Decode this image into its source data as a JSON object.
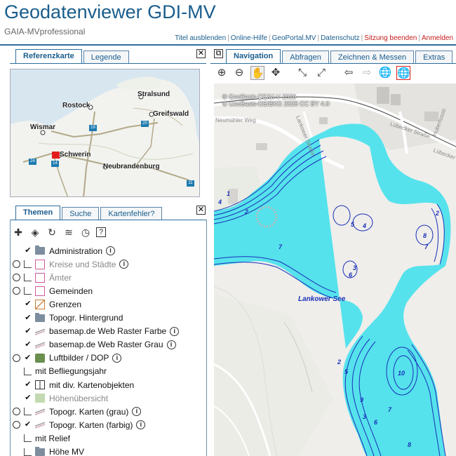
{
  "header": {
    "title": "Geodatenviewer GDI-MV",
    "subtitle": "GAIA-MVprofessional",
    "links": [
      {
        "label": "Titel ausblenden",
        "color": "#1a5d8c"
      },
      {
        "label": "Online-Hilfe",
        "color": "#1a5d8c"
      },
      {
        "label": "GeoPortal.MV",
        "color": "#1a5d8c"
      },
      {
        "label": "Datenschutz",
        "color": "#1a5d8c"
      },
      {
        "label": "Sitzung beenden",
        "color": "#c41b1b"
      },
      {
        "label": "Anmelden",
        "color": "#c41b1b"
      }
    ]
  },
  "left_top_tabs": [
    "Referenzkarte",
    "Legende"
  ],
  "refmap": {
    "cities": [
      "Stralsund",
      "Rostock",
      "Greifswald",
      "Wismar",
      "Schwerin",
      "Neubrandenburg"
    ],
    "road_badges": [
      "19",
      "20",
      "24",
      "14",
      "11"
    ]
  },
  "left_bottom_tabs": [
    "Themen",
    "Suche",
    "Kartenfehler?"
  ],
  "themes_toolbar_icons": [
    "plus-icon",
    "layers-icon",
    "refresh-icon",
    "layers-stack-icon",
    "clock-icon",
    "help-icon"
  ],
  "layers": [
    {
      "label": "Administration",
      "control": "check",
      "icon": "folder",
      "info": true,
      "level": 0,
      "dim": false
    },
    {
      "label": "Kreise und Städte",
      "control": "radio",
      "icon": "swatch",
      "info": true,
      "level": 1,
      "dim": true
    },
    {
      "label": "Ämter",
      "control": "radio",
      "icon": "swatch",
      "info": false,
      "level": 1,
      "dim": true
    },
    {
      "label": "Gemeinden",
      "control": "radio",
      "icon": "swatch",
      "info": false,
      "level": 1,
      "dim": false
    },
    {
      "label": "Grenzen",
      "control": "check",
      "icon": "swatch-orange",
      "info": false,
      "level": 1,
      "dim": false
    },
    {
      "label": "Topogr. Hintergrund",
      "control": "check",
      "icon": "folder",
      "info": false,
      "level": 0,
      "dim": false
    },
    {
      "label": "basemap.de Web Raster Farbe",
      "control": "check",
      "icon": "raster",
      "info": true,
      "level": 1,
      "dim": false
    },
    {
      "label": "basemap.de Web Raster Grau",
      "control": "check",
      "icon": "raster",
      "info": true,
      "level": 1,
      "dim": false
    },
    {
      "label": "Luftbilder / DOP",
      "control": "radio-check",
      "icon": "photo",
      "info": true,
      "level": 1,
      "dim": false
    },
    {
      "label": "mit Befliegungsjahr",
      "control": "ticks",
      "icon": "none",
      "info": false,
      "level": 2,
      "dim": false
    },
    {
      "label": "mit div. Kartenobjekten",
      "control": "check",
      "icon": "grid",
      "info": false,
      "level": 2,
      "dim": false
    },
    {
      "label": "Höhenübersicht",
      "control": "check",
      "icon": "relief",
      "info": false,
      "level": 2,
      "dim": true
    },
    {
      "label": "Topogr. Karten (grau)",
      "control": "radio-ticks",
      "icon": "raster",
      "info": true,
      "level": 1,
      "dim": false
    },
    {
      "label": "Topogr. Karten (farbig)",
      "control": "radio-check",
      "icon": "raster",
      "info": true,
      "level": 1,
      "dim": false
    },
    {
      "label": "mit Relief",
      "control": "ticks",
      "icon": "none",
      "info": false,
      "level": 2,
      "dim": false
    },
    {
      "label": "Höhe MV",
      "control": "ticks",
      "icon": "folder",
      "info": false,
      "level": 0,
      "dim": false
    }
  ],
  "right_tabs": [
    "Navigation",
    "Abfragen",
    "Zeichnen & Messen",
    "Extras"
  ],
  "map": {
    "copyright_lines": [
      "© GeoBasis-DE/M-V 2026",
      "© GeoBasis-DE/BKG 2026 CC BY 4.0"
    ],
    "lake_label": "Lankower See",
    "streets": [
      "Lübecker Straße",
      "Lankower Straße",
      "Neumühler Weg",
      "Lübecker",
      "Hubertusstr."
    ],
    "depths": [
      "1",
      "4",
      "2",
      "7",
      "5",
      "4",
      "2",
      "8",
      "7",
      "3",
      "6",
      "2",
      "5",
      "10",
      "7",
      "9",
      "3",
      "6",
      "8"
    ],
    "water_color": "#55e2ec",
    "contour_color": "#1a2fb8"
  }
}
